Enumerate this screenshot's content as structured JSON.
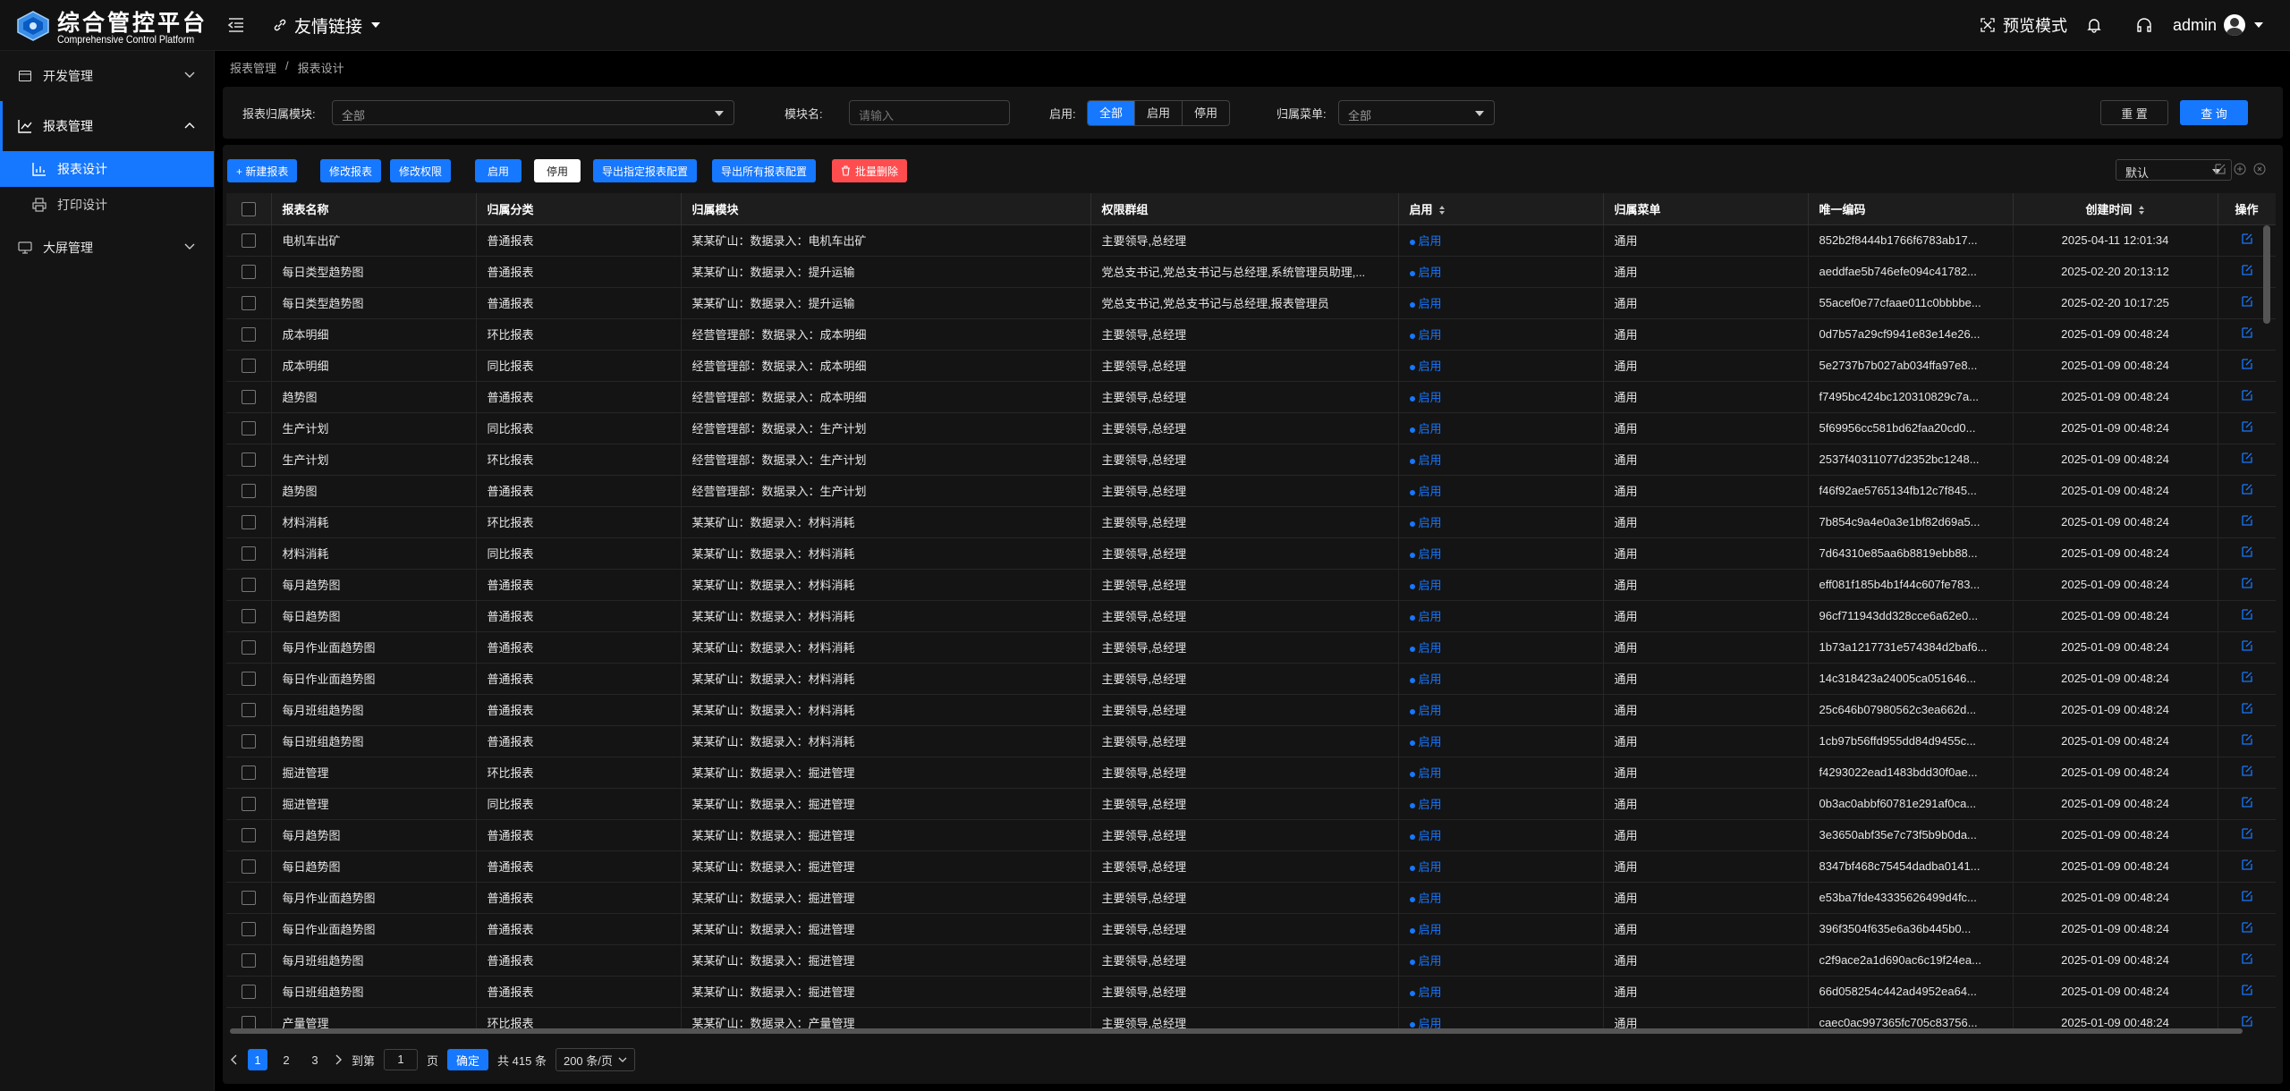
{
  "app": {
    "title": "综合管控平台",
    "subtitle": "Comprehensive Control Platform"
  },
  "header": {
    "friend_link": "友情链接",
    "preview_mode": "预览模式",
    "user": "admin"
  },
  "sidebar": {
    "items": [
      {
        "label": "开发管理",
        "icon": "code-icon"
      },
      {
        "label": "报表管理",
        "icon": "chart-icon"
      },
      {
        "label": "报表设计",
        "icon": "chart-bar-icon"
      },
      {
        "label": "打印设计",
        "icon": "printer-icon"
      },
      {
        "label": "大屏管理",
        "icon": "monitor-icon"
      }
    ]
  },
  "breadcrumb": {
    "root": "报表管理",
    "sep": "/",
    "current": "报表设计"
  },
  "filters": {
    "module_label": "报表归属模块:",
    "module_value": "全部",
    "name_label": "模块名:",
    "name_placeholder": "请输入",
    "enable_label": "启用:",
    "enable_options": [
      "全部",
      "启用",
      "停用"
    ],
    "menu_label": "归属菜单:",
    "menu_value": "全部",
    "reset": "重 置",
    "query": "查 询"
  },
  "toolbar": {
    "new": "+ 新建报表",
    "edit": "修改报表",
    "perm": "修改权限",
    "enable": "启用",
    "disable": "停用",
    "export_sel": "导出指定报表配置",
    "export_all": "导出所有报表配置",
    "batch_delete": "批量删除",
    "view": "默认"
  },
  "table": {
    "headers": [
      "报表名称",
      "归属分类",
      "归属模块",
      "权限群组",
      "启用",
      "归属菜单",
      "唯一编码",
      "创建时间",
      "操作"
    ],
    "rows": [
      [
        "电机车出矿",
        "普通报表",
        "某某矿山：数据录入：电机车出矿",
        "主要领导,总经理",
        "启用",
        "通用",
        "852b2f8444b1766f6783ab17...",
        "2025-04-11 12:01:34"
      ],
      [
        "每日类型趋势图",
        "普通报表",
        "某某矿山：数据录入：提升运输",
        "党总支书记,党总支书记与总经理,系统管理员助理,...",
        "启用",
        "通用",
        "aeddfae5b746efe094c41782...",
        "2025-02-20 20:13:12"
      ],
      [
        "每日类型趋势图",
        "普通报表",
        "某某矿山：数据录入：提升运输",
        "党总支书记,党总支书记与总经理,报表管理员",
        "启用",
        "通用",
        "55acef0e77cfaae011c0bbbbe...",
        "2025-02-20 10:17:25"
      ],
      [
        "成本明细",
        "环比报表",
        "经营管理部：数据录入：成本明细",
        "主要领导,总经理",
        "启用",
        "通用",
        "0d7b57a29cf9941e83e14e26...",
        "2025-01-09 00:48:24"
      ],
      [
        "成本明细",
        "同比报表",
        "经营管理部：数据录入：成本明细",
        "主要领导,总经理",
        "启用",
        "通用",
        "5e2737b7b027ab034ffa97e8...",
        "2025-01-09 00:48:24"
      ],
      [
        "趋势图",
        "普通报表",
        "经营管理部：数据录入：成本明细",
        "主要领导,总经理",
        "启用",
        "通用",
        "f7495bc424bc120310829c7a...",
        "2025-01-09 00:48:24"
      ],
      [
        "生产计划",
        "同比报表",
        "经营管理部：数据录入：生产计划",
        "主要领导,总经理",
        "启用",
        "通用",
        "5f69956cc581bd62faa20cd0...",
        "2025-01-09 00:48:24"
      ],
      [
        "生产计划",
        "环比报表",
        "经营管理部：数据录入：生产计划",
        "主要领导,总经理",
        "启用",
        "通用",
        "2537f40311077d2352bc1248...",
        "2025-01-09 00:48:24"
      ],
      [
        "趋势图",
        "普通报表",
        "经营管理部：数据录入：生产计划",
        "主要领导,总经理",
        "启用",
        "通用",
        "f46f92ae5765134fb12c7f845...",
        "2025-01-09 00:48:24"
      ],
      [
        "材料消耗",
        "环比报表",
        "某某矿山：数据录入：材料消耗",
        "主要领导,总经理",
        "启用",
        "通用",
        "7b854c9a4e0a3e1bf82d69a5...",
        "2025-01-09 00:48:24"
      ],
      [
        "材料消耗",
        "同比报表",
        "某某矿山：数据录入：材料消耗",
        "主要领导,总经理",
        "启用",
        "通用",
        "7d64310e85aa6b8819ebb88...",
        "2025-01-09 00:48:24"
      ],
      [
        "每月趋势图",
        "普通报表",
        "某某矿山：数据录入：材料消耗",
        "主要领导,总经理",
        "启用",
        "通用",
        "eff081f185b4b1f44c607fe783...",
        "2025-01-09 00:48:24"
      ],
      [
        "每日趋势图",
        "普通报表",
        "某某矿山：数据录入：材料消耗",
        "主要领导,总经理",
        "启用",
        "通用",
        "96cf711943dd328cce6a62e0...",
        "2025-01-09 00:48:24"
      ],
      [
        "每月作业面趋势图",
        "普通报表",
        "某某矿山：数据录入：材料消耗",
        "主要领导,总经理",
        "启用",
        "通用",
        "1b73a1217731e574384d2baf6...",
        "2025-01-09 00:48:24"
      ],
      [
        "每日作业面趋势图",
        "普通报表",
        "某某矿山：数据录入：材料消耗",
        "主要领导,总经理",
        "启用",
        "通用",
        "14c318423a24005ca051646...",
        "2025-01-09 00:48:24"
      ],
      [
        "每月班组趋势图",
        "普通报表",
        "某某矿山：数据录入：材料消耗",
        "主要领导,总经理",
        "启用",
        "通用",
        "25c646b07980562c3ea662d...",
        "2025-01-09 00:48:24"
      ],
      [
        "每日班组趋势图",
        "普通报表",
        "某某矿山：数据录入：材料消耗",
        "主要领导,总经理",
        "启用",
        "通用",
        "1cb97b56ffd955dd84d9455c...",
        "2025-01-09 00:48:24"
      ],
      [
        "掘进管理",
        "环比报表",
        "某某矿山：数据录入：掘进管理",
        "主要领导,总经理",
        "启用",
        "通用",
        "f4293022ead1483bdd30f0ae...",
        "2025-01-09 00:48:24"
      ],
      [
        "掘进管理",
        "同比报表",
        "某某矿山：数据录入：掘进管理",
        "主要领导,总经理",
        "启用",
        "通用",
        "0b3ac0abbf60781e291af0ca...",
        "2025-01-09 00:48:24"
      ],
      [
        "每月趋势图",
        "普通报表",
        "某某矿山：数据录入：掘进管理",
        "主要领导,总经理",
        "启用",
        "通用",
        "3e3650abf35e7c73f5b9b0da...",
        "2025-01-09 00:48:24"
      ],
      [
        "每日趋势图",
        "普通报表",
        "某某矿山：数据录入：掘进管理",
        "主要领导,总经理",
        "启用",
        "通用",
        "8347bf468c75454dadba0141...",
        "2025-01-09 00:48:24"
      ],
      [
        "每月作业面趋势图",
        "普通报表",
        "某某矿山：数据录入：掘进管理",
        "主要领导,总经理",
        "启用",
        "通用",
        "e53ba7fde43335626499d4fc...",
        "2025-01-09 00:48:24"
      ],
      [
        "每日作业面趋势图",
        "普通报表",
        "某某矿山：数据录入：掘进管理",
        "主要领导,总经理",
        "启用",
        "通用",
        "396f3504f635e6a36b445b0...",
        "2025-01-09 00:48:24"
      ],
      [
        "每月班组趋势图",
        "普通报表",
        "某某矿山：数据录入：掘进管理",
        "主要领导,总经理",
        "启用",
        "通用",
        "c2f9ace2a1d690ac6c19f24ea...",
        "2025-01-09 00:48:24"
      ],
      [
        "每日班组趋势图",
        "普通报表",
        "某某矿山：数据录入：掘进管理",
        "主要领导,总经理",
        "启用",
        "通用",
        "66d058254c442ad4952ea64...",
        "2025-01-09 00:48:24"
      ],
      [
        "产量管理",
        "环比报表",
        "某某矿山：数据录入：产量管理",
        "主要领导,总经理",
        "启用",
        "通用",
        "caec0ac997365fc705c83756...",
        "2025-01-09 00:48:24"
      ]
    ]
  },
  "pagination": {
    "pages": [
      "1",
      "2",
      "3"
    ],
    "goto_label": "到第",
    "goto_value": "1",
    "page_unit": "页",
    "confirm": "确定",
    "total": "共 415 条",
    "page_size": "200 条/页"
  },
  "colors": {
    "accent": "#1677ff",
    "danger": "#ff4d4f",
    "bg": "#141414"
  }
}
